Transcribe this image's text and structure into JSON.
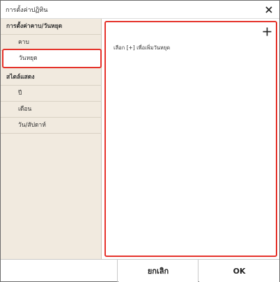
{
  "window": {
    "title": "การตั้งค่าปฏิทิน",
    "close_icon": "close-icon"
  },
  "sidebar": {
    "section1_title": "การตั้งค่าคาบ/วันหยุด",
    "items1": [
      {
        "label": "คาบ"
      },
      {
        "label": "วันหยุด",
        "selected": true
      }
    ],
    "section2_title": "สไตล์แสดง",
    "items2": [
      {
        "label": "ปี"
      },
      {
        "label": "เดือน"
      },
      {
        "label": "วัน/สัปดาห์"
      }
    ]
  },
  "panel": {
    "add_icon": "plus-icon",
    "hint_text": "เลือก [+] เพื่อเพิ่มวันหยุด"
  },
  "footer": {
    "cancel_label": "ยกเลิก",
    "ok_label": "OK"
  },
  "colors": {
    "highlight": "#e5322a",
    "sidebar_bg": "#f1eadf"
  }
}
